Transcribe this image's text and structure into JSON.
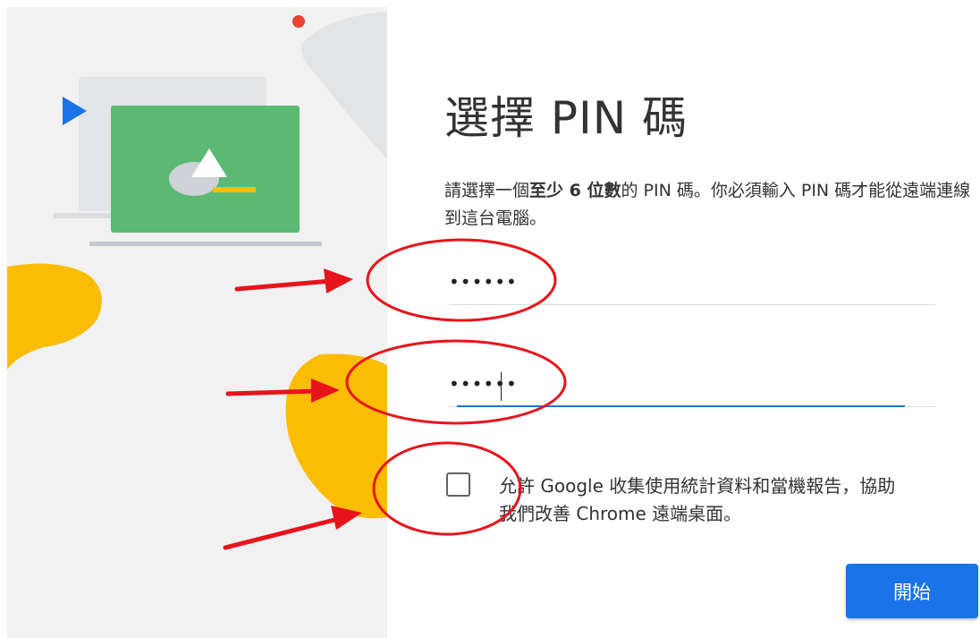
{
  "setup": {
    "title": "選擇 PIN 碼",
    "desc_pre": "請選擇一個",
    "desc_bold": "至少 6 位數",
    "desc_post": "的 PIN 碼。你必須輸入 PIN 碼才能從遠端連線到這台電腦。",
    "pin_value": "••••••",
    "pin_confirm_value": "••••••",
    "checkbox_label": "允許 Google 收集使用統計資料和當機報告，協助我們改善 Chrome 遠端桌面。",
    "checkbox_checked": false,
    "start_button": "開始"
  },
  "colors": {
    "accent": "#1a73e8",
    "illustration_green": "#5bb974",
    "illustration_yellow": "#fbbc04",
    "illustration_blue": "#1a73e8",
    "illustration_red": "#ea4335",
    "annotation_red": "#e8141b"
  }
}
